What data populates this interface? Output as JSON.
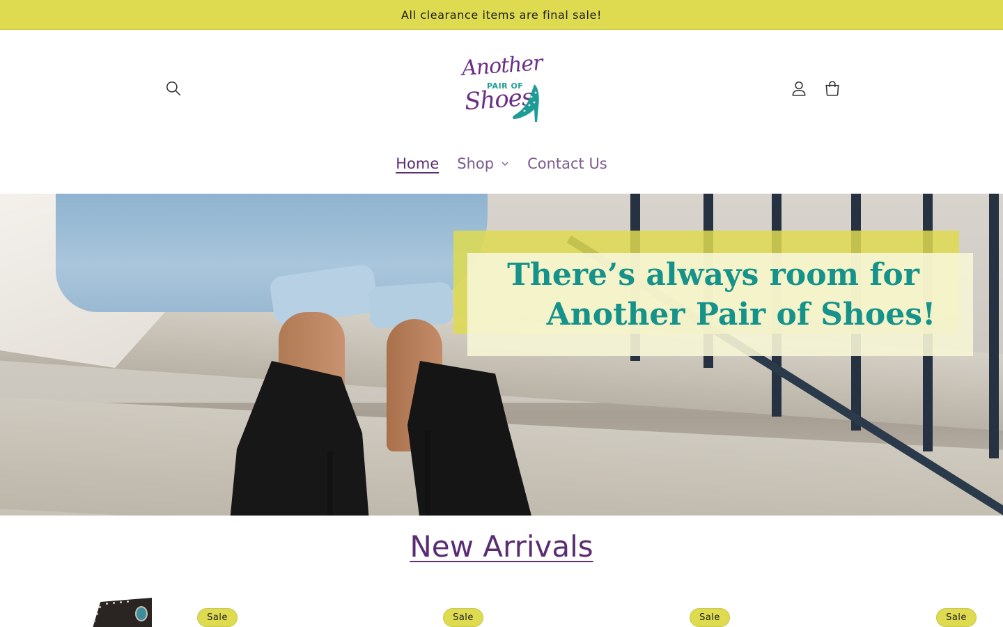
{
  "announcement": {
    "text": "All clearance items are final sale!"
  },
  "header": {
    "logo": {
      "line1": "Another",
      "line2": "PAIR OF",
      "line3": "Shoes"
    },
    "icons": {
      "search": "search-icon",
      "account": "account-icon",
      "cart": "cart-icon"
    }
  },
  "nav": {
    "items": [
      {
        "label": "Home",
        "active": true
      },
      {
        "label": "Shop",
        "has_dropdown": true
      },
      {
        "label": "Contact Us"
      }
    ]
  },
  "hero": {
    "line1": "There’s always room for",
    "line2": "Another Pair of Shoes!"
  },
  "new_arrivals": {
    "title": "New Arrivals",
    "badges": [
      "Sale",
      "Sale",
      "Sale",
      "Sale"
    ]
  },
  "colors": {
    "accent_yellow": "#dedb50",
    "brand_purple": "#5a2d73",
    "brand_teal": "#15928a"
  }
}
